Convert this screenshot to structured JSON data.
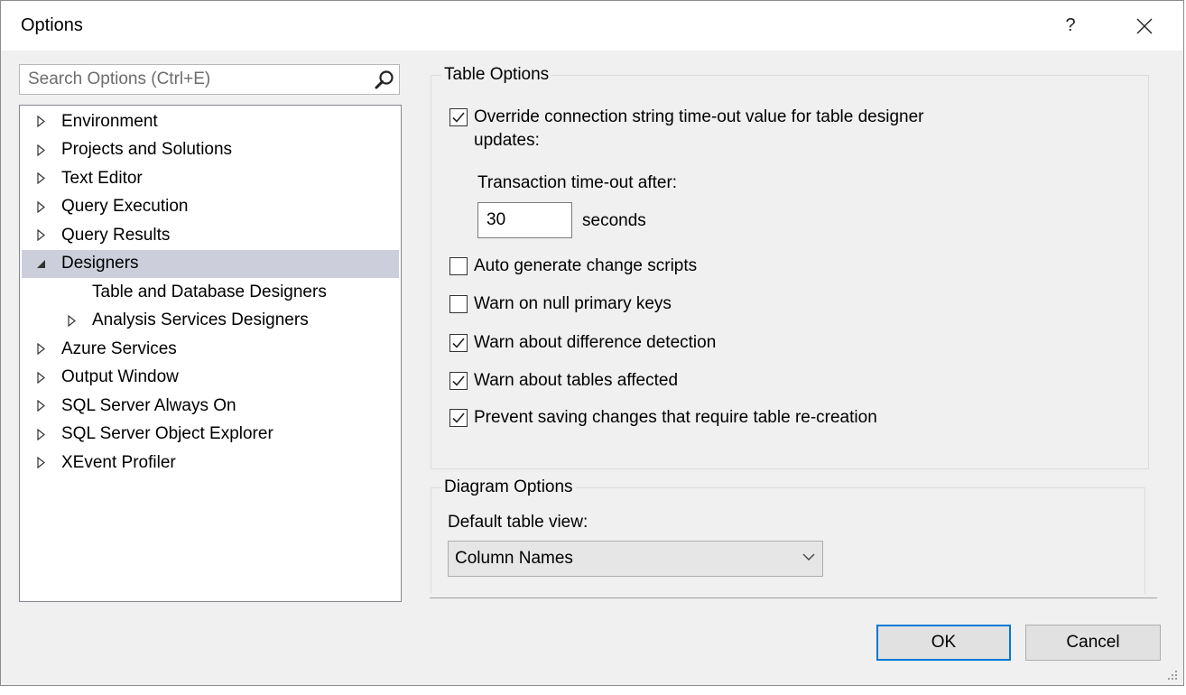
{
  "window": {
    "title": "Options",
    "help_label": "?"
  },
  "search": {
    "placeholder": "Search Options (Ctrl+E)",
    "icon": "search-icon"
  },
  "tree": {
    "items": [
      {
        "label": "Environment",
        "state": "collapsed",
        "level": 0
      },
      {
        "label": "Projects and Solutions",
        "state": "collapsed",
        "level": 0
      },
      {
        "label": "Text Editor",
        "state": "collapsed",
        "level": 0
      },
      {
        "label": "Query Execution",
        "state": "collapsed",
        "level": 0
      },
      {
        "label": "Query Results",
        "state": "collapsed",
        "level": 0
      },
      {
        "label": "Designers",
        "state": "expanded",
        "level": 0,
        "selected": true
      },
      {
        "label": "Table and Database Designers",
        "state": "leaf",
        "level": 1
      },
      {
        "label": "Analysis Services Designers",
        "state": "collapsed",
        "level": 1
      },
      {
        "label": "Azure Services",
        "state": "collapsed",
        "level": 0
      },
      {
        "label": "Output Window",
        "state": "collapsed",
        "level": 0
      },
      {
        "label": "SQL Server Always On",
        "state": "collapsed",
        "level": 0
      },
      {
        "label": "SQL Server Object Explorer",
        "state": "collapsed",
        "level": 0
      },
      {
        "label": "XEvent Profiler",
        "state": "collapsed",
        "level": 0
      }
    ]
  },
  "table_options": {
    "title": "Table Options",
    "override": {
      "label_line1": "Override connection string time-out value for table designer",
      "label_line2": "updates:",
      "checked": true
    },
    "transaction_label": "Transaction time-out after:",
    "timeout_value": "30",
    "seconds_label": "seconds",
    "checkboxes": [
      {
        "label": "Auto generate change scripts",
        "checked": false
      },
      {
        "label": "Warn on null primary keys",
        "checked": false
      },
      {
        "label": "Warn about difference detection",
        "checked": true
      },
      {
        "label": "Warn about tables affected",
        "checked": true
      },
      {
        "label": "Prevent saving changes that require table re-creation",
        "checked": true
      }
    ]
  },
  "diagram_options": {
    "title": "Diagram Options",
    "default_view_label": "Default table view:",
    "default_view_value": "Column Names"
  },
  "buttons": {
    "ok": "OK",
    "cancel": "Cancel"
  },
  "colors": {
    "selection": "#cccedb",
    "focus_border": "#0078d7",
    "dialog_bg": "#f0f0f0"
  }
}
